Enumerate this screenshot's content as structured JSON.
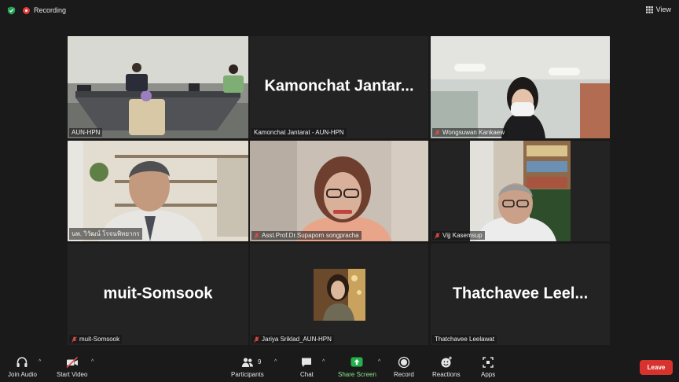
{
  "topbar": {
    "recording_label": "Recording",
    "view_label": "View"
  },
  "tiles": {
    "t1": {
      "label": "AUN-HPN"
    },
    "t2": {
      "big_name": "Kamonchat  Jantar...",
      "label": "Kamonchat Jantarat - AUN-HPN"
    },
    "t3": {
      "label": "Wongsuwan Kankaew"
    },
    "t4": {
      "label": "นพ. วิวัฒน์ โรจนพิทยากร"
    },
    "t5": {
      "label": "Asst.Prof.Dr.Supaporn songpracha"
    },
    "t6": {
      "label": "Vijj Kasemsup"
    },
    "t7": {
      "big_name": "muit-Somsook",
      "label": "muit-Somsook"
    },
    "t8": {
      "label": "Jariya Sriklad_AUN-HPN"
    },
    "t9": {
      "big_name": "Thatchavee  Leel...",
      "label": "Thatchavee Leelawat"
    }
  },
  "toolbar": {
    "join_audio": "Join Audio",
    "start_video": "Start Video",
    "participants": "Participants",
    "participants_count": "9",
    "chat": "Chat",
    "share_screen": "Share Screen",
    "record": "Record",
    "reactions": "Reactions",
    "apps": "Apps",
    "leave": "Leave"
  },
  "colors": {
    "active_speaker": "#b7d33c",
    "leave_red": "#d7322e",
    "share_green": "#22b14c",
    "recording_red": "#e23c35"
  }
}
